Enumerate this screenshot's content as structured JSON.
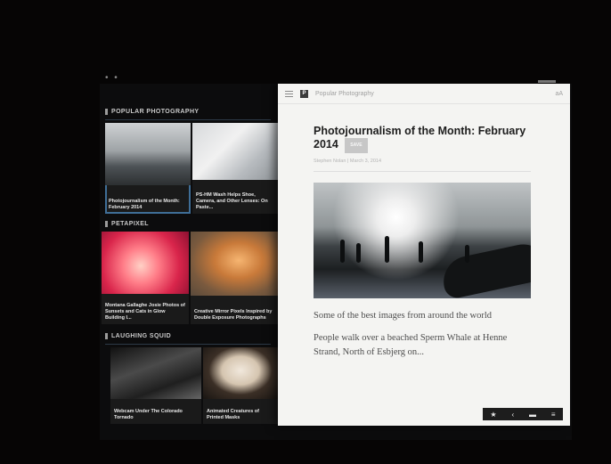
{
  "status": {
    "dots": "• •"
  },
  "river": {
    "sections": [
      {
        "title": "POPULAR PHOTOGRAPHY",
        "tiles": [
          {
            "caption": "Photojournalism of the Month: February 2014",
            "image": "beach-photo"
          },
          {
            "caption": "PS-HM Wash Helps Shoe, Camera, and Other Lenses: On Paste...",
            "image": "paper-photo"
          }
        ]
      },
      {
        "title": "PETAPIXEL",
        "tiles": [
          {
            "caption": "Montana Gallaghe Josie Photos of Sunsets and Cats in Glow Building I...",
            "image": "pink-photo"
          },
          {
            "caption": "Creative Mirror Pixels Inspired by Double Exposure Photographs",
            "image": "amber-photo"
          }
        ]
      },
      {
        "title": "LAUGHING SQUID",
        "tiles": [
          {
            "caption": "Webcam Under The Colorado Tornado",
            "image": "storm-photo"
          },
          {
            "caption": "Animated Creatures of Printed Masks",
            "image": "mask-photo"
          }
        ]
      }
    ]
  },
  "panel": {
    "source_name": "Popular Photography",
    "font_button": "aA",
    "logo_letter": "P",
    "title": "Photojournalism of the Month: February 2014",
    "badge": "SAVE",
    "byline": "Stephen Nolan | March 3, 2014",
    "lede": "Some of the best images from around the world",
    "body": "People walk over a beached Sperm Whale at Henne Strand, North of Esbjerg on..."
  },
  "actions": {
    "star": "★",
    "share": "‹",
    "comment": "▬",
    "more": "≡"
  },
  "colors": {
    "accent": "#3f6e97",
    "panel_bg": "#f4f4f2",
    "screen_bg": "#0c0c0d"
  }
}
